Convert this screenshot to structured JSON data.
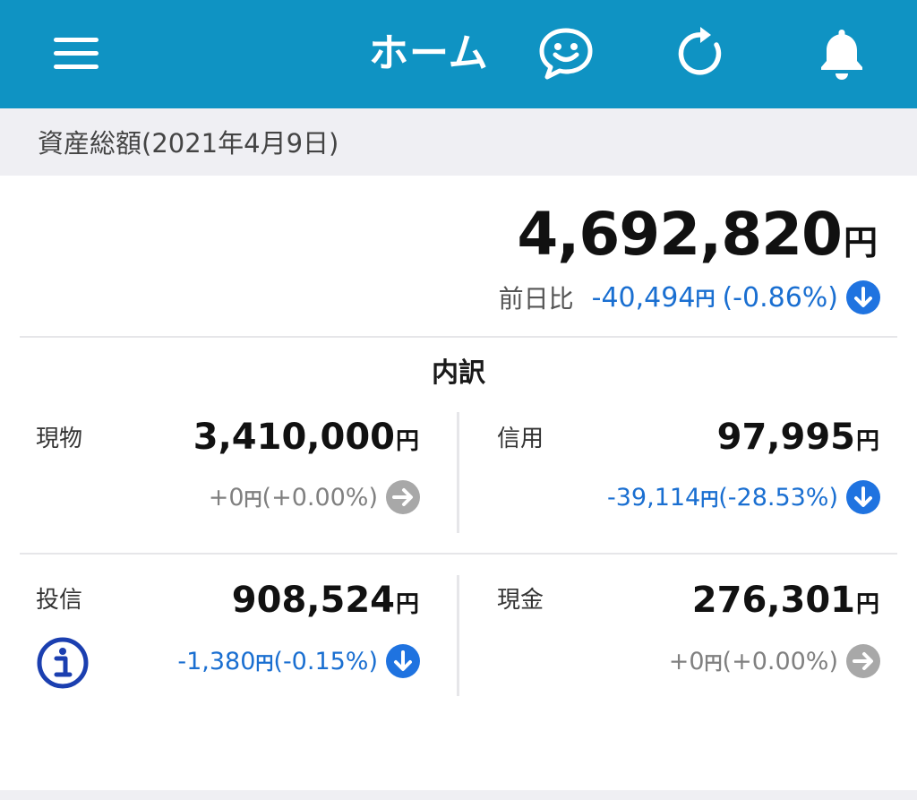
{
  "header": {
    "title": "ホーム",
    "menu_icon": "hamburger-menu-icon",
    "chat_icon": "smiley-chat-icon",
    "refresh_icon": "refresh-icon",
    "bell_icon": "bell-icon",
    "background_color": "#0f93c3"
  },
  "summary": {
    "date_label": "資産総額(2021年4月9日)",
    "total_value": "4,692,820",
    "unit": "円",
    "diff_label": "前日比",
    "diff_value": "-40,494",
    "diff_pct": "(-0.86%)",
    "diff_direction": "down"
  },
  "breakdown": {
    "title": "内訳",
    "items": [
      {
        "label": "現物",
        "value": "3,410,000",
        "unit": "円",
        "diff_value": "+0",
        "diff_pct": "(+0.00%)",
        "direction": "flat"
      },
      {
        "label": "信用",
        "value": "97,995",
        "unit": "円",
        "diff_value": "-39,114",
        "diff_pct": "(-28.53%)",
        "direction": "down"
      },
      {
        "label": "投信",
        "value": "908,524",
        "unit": "円",
        "diff_value": "-1,380",
        "diff_pct": "(-0.15%)",
        "direction": "down"
      },
      {
        "label": "現金",
        "value": "276,301",
        "unit": "円",
        "diff_value": "+0",
        "diff_pct": "(+0.00%)",
        "direction": "flat"
      }
    ]
  },
  "colors": {
    "negative": "#1a6fd1",
    "neutral": "#808080",
    "down_badge": "#1f73e0",
    "flat_badge": "#a8a8a8",
    "info_icon": "#1b3fb0"
  }
}
